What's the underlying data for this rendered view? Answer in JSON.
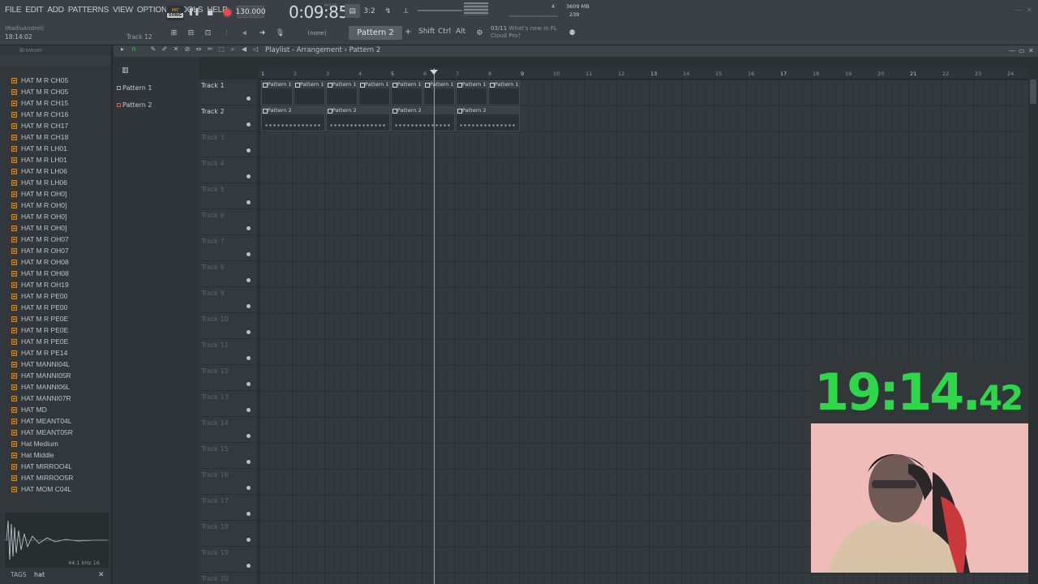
{
  "menu": [
    "FILE",
    "EDIT",
    "ADD",
    "PATTERNS",
    "VIEW",
    "OPTIONS",
    "TOOLS",
    "HELP"
  ],
  "info": {
    "user": "(RadiuAndrei)",
    "time": "18:14:02",
    "hint": "Track 12"
  },
  "transport": {
    "mode": "SONG",
    "tempo": "130.000",
    "clock": "0:09:85",
    "clock_label": "M:S:CS"
  },
  "stats": {
    "memory": "3609 MB",
    "cpu": "239",
    "voices": "4"
  },
  "toolbar2": {
    "snap": "(none)",
    "pattern": "Pattern 2",
    "keys": [
      "Shift",
      "Ctrl",
      "Alt"
    ],
    "news_count": "03/11",
    "news_line1": "What's new in FL",
    "news_line2": "Cloud Pro?"
  },
  "browser": {
    "title": "Browser",
    "files": [
      "HAT M R CH05",
      "HAT M R CH05",
      "HAT M R CH15",
      "HAT M R CH16",
      "HAT M R CH17",
      "HAT M R CH18",
      "HAT M R LH01",
      "HAT M R LH01",
      "HAT M R LH06",
      "HAT M R LH06",
      "HAT M R OH0]",
      "HAT M R OH0]",
      "HAT M R OH0]",
      "HAT M R OH0]",
      "HAT M R OH07",
      "HAT M R OH07",
      "HAT M R OH08",
      "HAT M R OH08",
      "HAT M R OH19",
      "HAT M R PE00",
      "HAT M R PE00",
      "HAT M R PE0E",
      "HAT M R PE0E",
      "HAT M R PE0E",
      "HAT M R PE14",
      "HAT MANNI04L",
      "HAT MANNI05R",
      "HAT MANNI06L",
      "HAT MANNI07R",
      "HAT MD",
      "HAT MEANT04L",
      "HAT MEANT05R",
      "Hat Medium",
      "Hat Middle",
      "HAT MIRROO4L",
      "HAT MIRROO5R",
      "HAT MOM C04L"
    ],
    "sample_info": "44.1 kHz 16",
    "tags_label": "TAGS",
    "tags_value": "hat"
  },
  "playlist": {
    "breadcrumb": "Playlist - Arrangement",
    "current_pattern": "Pattern 2",
    "patterns": [
      "Pattern 1",
      "Pattern 2"
    ],
    "ruler": [
      "1",
      "2",
      "3",
      "4",
      "5",
      "6",
      "7",
      "8",
      "9",
      "10",
      "11",
      "12",
      "13",
      "14",
      "15",
      "16",
      "17",
      "18",
      "19",
      "20",
      "21",
      "22",
      "23",
      "24"
    ],
    "tracks": [
      "Track 1",
      "Track 2",
      "Track 3",
      "Track 4",
      "Track 5",
      "Track 6",
      "Track 7",
      "Track 8",
      "Track 9",
      "Track 10",
      "Track 11",
      "Track 12",
      "Track 13",
      "Track 14",
      "Track 15",
      "Track 16",
      "Track 17",
      "Track 18",
      "Track 19",
      "Track 20"
    ],
    "track1_clips": [
      "Pattern 1",
      "Pattern 1",
      "Pattern 1",
      "Pattern 1",
      "Pattern 1",
      "Pattern 1",
      "Pattern 1",
      "Pattern 1"
    ],
    "track2_clips": [
      "Pattern 2",
      "Pattern 2",
      "Pattern 2",
      "Pattern 2"
    ]
  },
  "overlay": {
    "timer_main": "19:14.",
    "timer_fraction": "42"
  }
}
